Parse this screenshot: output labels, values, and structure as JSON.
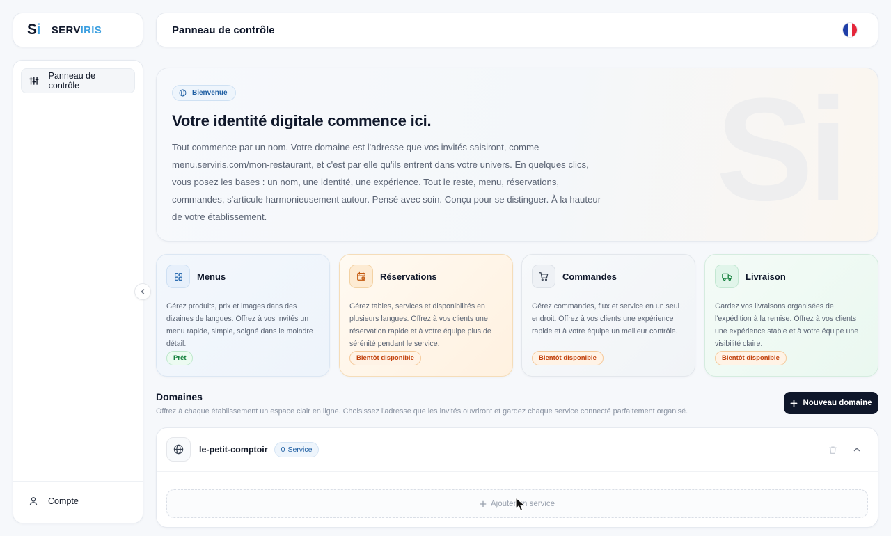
{
  "brand": {
    "mark_s": "S",
    "mark_i": "i",
    "name_part1": "SERV",
    "name_part2": "IRIS"
  },
  "header": {
    "title": "Panneau de contrôle",
    "language_flag": "fr-flag-icon"
  },
  "sidebar": {
    "items": [
      {
        "label": "Panneau de contrôle",
        "icon": "sliders-icon",
        "active": true
      }
    ],
    "footer": {
      "label": "Compte",
      "icon": "user-icon"
    }
  },
  "hero": {
    "badge": "Bienvenue",
    "title": "Votre identité digitale commence ici.",
    "text": "Tout commence par un nom. Votre domaine est l'adresse que vos invités saisiront, comme menu.serviris.com/mon-restaurant, et c'est par elle qu'ils entrent dans votre univers. En quelques clics, vous posez les bases : un nom, une identité, une expérience. Tout le reste, menu, réservations, commandes, s'articule harmonieusement autour. Pensé avec soin. Conçu pour se distinguer. À la hauteur de votre établissement.",
    "watermark": "Si"
  },
  "cards": [
    {
      "title": "Menus",
      "icon": "grid-icon",
      "description": "Gérez produits, prix et images dans des dizaines de langues. Offrez à vos invités un menu rapide, simple, soigné dans le moindre détail.",
      "status": "Prêt"
    },
    {
      "title": "Réservations",
      "icon": "calendar-icon",
      "description": "Gérez tables, services et disponibilités en plusieurs langues. Offrez à vos clients une réservation rapide et à votre équipe plus de sérénité pendant le service.",
      "status": "Bientôt disponible"
    },
    {
      "title": "Commandes",
      "icon": "cart-icon",
      "description": "Gérez commandes, flux et service en un seul endroit. Offrez à vos clients une expérience rapide et à votre équipe un meilleur contrôle.",
      "status": "Bientôt disponible"
    },
    {
      "title": "Livraison",
      "icon": "truck-icon",
      "description": "Gardez vos livraisons organisées de l'expédition à la remise. Offrez à vos clients une expérience stable et à votre équipe une visibilité claire.",
      "status": "Bientôt disponible"
    }
  ],
  "domains": {
    "title": "Domaines",
    "subtitle": "Offrez à chaque établissement un espace clair en ligne. Choisissez l'adresse que les invités ouvriront et gardez chaque service connecté parfaitement organisé.",
    "new_button": "Nouveau domaine",
    "items": [
      {
        "name": "le-petit-comptoir",
        "service_count": "0",
        "service_label": "Service",
        "add_service_label": "Ajouter un service"
      }
    ]
  },
  "colors": {
    "accent": "#3b9fe0",
    "dark": "#0f172a",
    "green": "#15803d",
    "orange": "#c2410c"
  }
}
